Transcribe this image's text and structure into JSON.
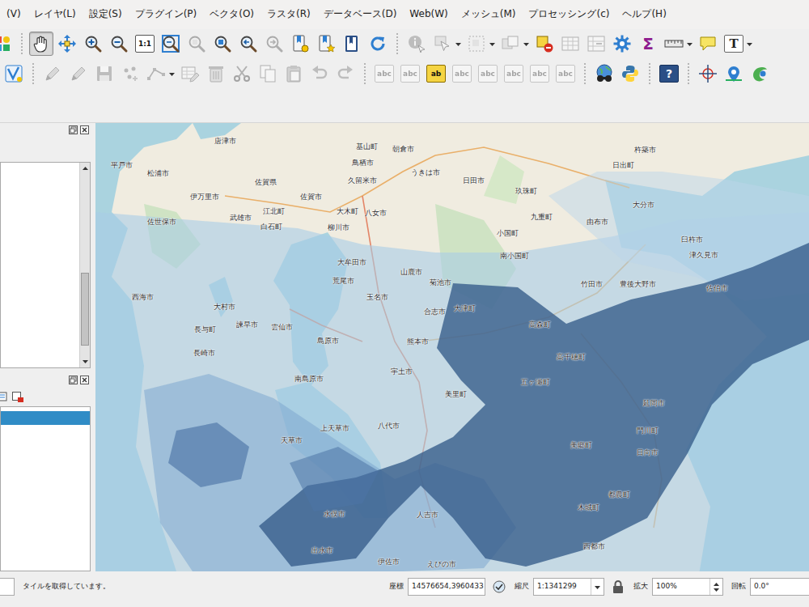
{
  "menu": [
    "(V)",
    "レイヤ(L)",
    "設定(S)",
    "プラグイン(P)",
    "ベクタ(O)",
    "ラスタ(R)",
    "データベース(D)",
    "Web(W)",
    "メッシュ(M)",
    "プロセッシング(c)",
    "ヘルプ(H)"
  ],
  "toolbars": {
    "navigation": [
      [
        {
          "kind": "style",
          "disabled": false,
          "selected": false,
          "dropdown": false
        }
      ],
      [
        {
          "kind": "pan",
          "disabled": false,
          "selected": true,
          "dropdown": false
        },
        {
          "kind": "pan-select",
          "disabled": false,
          "selected": false,
          "dropdown": false
        },
        {
          "kind": "zoom-in",
          "disabled": false,
          "selected": false,
          "dropdown": false
        },
        {
          "kind": "zoom-out",
          "disabled": false,
          "selected": false,
          "dropdown": false
        },
        {
          "kind": "zoom-native",
          "glyph": "1:1",
          "disabled": false,
          "selected": false,
          "dropdown": false
        },
        {
          "kind": "zoom-full",
          "disabled": false,
          "selected": false,
          "dropdown": false
        },
        {
          "kind": "zoom-select",
          "disabled": true,
          "selected": false,
          "dropdown": false
        },
        {
          "kind": "zoom-layer",
          "disabled": false,
          "selected": false,
          "dropdown": false
        },
        {
          "kind": "zoom-last",
          "disabled": false,
          "selected": false,
          "dropdown": false
        },
        {
          "kind": "zoom-next",
          "disabled": true,
          "selected": false,
          "dropdown": false
        },
        {
          "kind": "bookmark-new",
          "disabled": false,
          "selected": false,
          "dropdown": false
        },
        {
          "kind": "bookmark-show",
          "disabled": false,
          "selected": false,
          "dropdown": false
        },
        {
          "kind": "bookmark",
          "disabled": false,
          "selected": false,
          "dropdown": false
        },
        {
          "kind": "refresh",
          "disabled": false,
          "selected": false,
          "dropdown": false
        }
      ],
      [
        {
          "kind": "identify",
          "disabled": true,
          "selected": false,
          "dropdown": false
        },
        {
          "kind": "select",
          "disabled": true,
          "selected": false,
          "dropdown": true
        },
        {
          "kind": "select-area",
          "disabled": true,
          "selected": false,
          "dropdown": true
        },
        {
          "kind": "deselect",
          "disabled": true,
          "selected": false,
          "dropdown": true
        },
        {
          "kind": "deselect-all",
          "disabled": false,
          "selected": false,
          "dropdown": false
        },
        {
          "kind": "table",
          "disabled": true,
          "selected": false,
          "dropdown": false
        },
        {
          "kind": "field-calc",
          "disabled": true,
          "selected": false,
          "dropdown": false
        },
        {
          "kind": "gear",
          "disabled": false,
          "selected": false,
          "dropdown": false
        },
        {
          "kind": "sigma",
          "glyph": "Σ",
          "disabled": false,
          "selected": false,
          "dropdown": false
        },
        {
          "kind": "measure",
          "disabled": false,
          "selected": false,
          "dropdown": true
        },
        {
          "kind": "annotation",
          "disabled": false,
          "selected": false,
          "dropdown": false
        },
        {
          "kind": "text",
          "glyph": "T",
          "disabled": false,
          "selected": false,
          "dropdown": true
        }
      ]
    ],
    "digitizing": [
      [
        {
          "kind": "digitize",
          "disabled": false,
          "selected": false,
          "dropdown": false
        }
      ],
      [
        {
          "kind": "pencil",
          "disabled": true,
          "selected": false,
          "dropdown": false
        },
        {
          "kind": "pencil",
          "disabled": true,
          "selected": false,
          "dropdown": false
        },
        {
          "kind": "save",
          "disabled": true,
          "selected": false,
          "dropdown": false
        },
        {
          "kind": "add-point",
          "disabled": true,
          "selected": false,
          "dropdown": false
        },
        {
          "kind": "node",
          "disabled": true,
          "selected": false,
          "dropdown": true
        },
        {
          "kind": "edit-attr",
          "disabled": true,
          "selected": false,
          "dropdown": false
        },
        {
          "kind": "delete",
          "disabled": true,
          "selected": false,
          "dropdown": false
        },
        {
          "kind": "cut",
          "disabled": true,
          "selected": false,
          "dropdown": false
        },
        {
          "kind": "copy",
          "disabled": true,
          "selected": false,
          "dropdown": false
        },
        {
          "kind": "paste",
          "disabled": true,
          "selected": false,
          "dropdown": false
        },
        {
          "kind": "undo",
          "disabled": true,
          "selected": false,
          "dropdown": false
        },
        {
          "kind": "redo",
          "disabled": true,
          "selected": false,
          "dropdown": false
        }
      ],
      [
        {
          "kind": "label",
          "glyph": "abc",
          "disabled": true,
          "selected": false,
          "dropdown": false
        },
        {
          "kind": "label",
          "glyph": "abc",
          "disabled": true,
          "selected": false,
          "dropdown": false
        },
        {
          "kind": "label-on",
          "glyph": "ab",
          "disabled": false,
          "selected": false,
          "dropdown": false
        },
        {
          "kind": "label",
          "glyph": "abc",
          "disabled": true,
          "selected": false,
          "dropdown": false
        },
        {
          "kind": "label",
          "glyph": "abc",
          "disabled": true,
          "selected": false,
          "dropdown": false
        },
        {
          "kind": "label",
          "glyph": "abc",
          "disabled": true,
          "selected": false,
          "dropdown": false
        },
        {
          "kind": "label",
          "glyph": "abc",
          "disabled": true,
          "selected": false,
          "dropdown": false
        },
        {
          "kind": "label",
          "glyph": "abc",
          "disabled": true,
          "selected": false,
          "dropdown": false
        }
      ],
      [
        {
          "kind": "metasearch",
          "disabled": false,
          "selected": false,
          "dropdown": false
        },
        {
          "kind": "python",
          "disabled": false,
          "selected": false,
          "dropdown": false
        }
      ],
      [
        {
          "kind": "help",
          "glyph": "?",
          "disabled": false,
          "selected": false,
          "dropdown": false
        }
      ],
      [
        {
          "kind": "crosshair",
          "disabled": false,
          "selected": false,
          "dropdown": false
        },
        {
          "kind": "coord",
          "disabled": false,
          "selected": false,
          "dropdown": false
        },
        {
          "kind": "plugin",
          "disabled": false,
          "selected": false,
          "dropdown": false
        }
      ]
    ]
  },
  "layers_panel": {
    "rows": [
      {
        "selected": true
      }
    ]
  },
  "map": {
    "labels": [
      "唐津市",
      "基山町",
      "朝倉市",
      "杵築市",
      "平戸市",
      "鳥栖市",
      "日出町",
      "松浦市",
      "うきは市",
      "日田市",
      "佐賀県",
      "久留米市",
      "玖珠町",
      "伊万里市",
      "佐賀市",
      "大分市",
      "江北町",
      "大木町",
      "八女市",
      "佐世保市",
      "武雄市",
      "九重町",
      "由布市",
      "白石町",
      "柳川市",
      "小国町",
      "臼杵市",
      "南小国町",
      "大牟田市",
      "津久見市",
      "山鹿市",
      "荒尾市",
      "菊池市",
      "竹田市",
      "豊後大野市",
      "佐伯市",
      "西海市",
      "玉名市",
      "大村市",
      "合志市",
      "大津町",
      "諫早市",
      "雲仙市",
      "長与町",
      "高森町",
      "長崎市",
      "島原市",
      "熊本市",
      "高千穂町",
      "五ヶ瀬町",
      "宇土市",
      "南島原市",
      "美里町",
      "延岡市",
      "門川町",
      "八代市",
      "上天草市",
      "天草市",
      "美郷町",
      "日向市",
      "水俣市",
      "人吉市",
      "都農町",
      "木城町",
      "出水市",
      "伊佐市",
      "えびの市",
      "西都市"
    ]
  },
  "status_bar": {
    "message": "タイルを取得しています。",
    "coordinate_label": "座標",
    "coordinate": "14576654,3960433",
    "scale_label": "縮尺",
    "scale": "1:1341299",
    "magnifier_label": "拡大",
    "magnifier": "100%",
    "rotation_label": "回転",
    "rotation": "0.0°"
  }
}
